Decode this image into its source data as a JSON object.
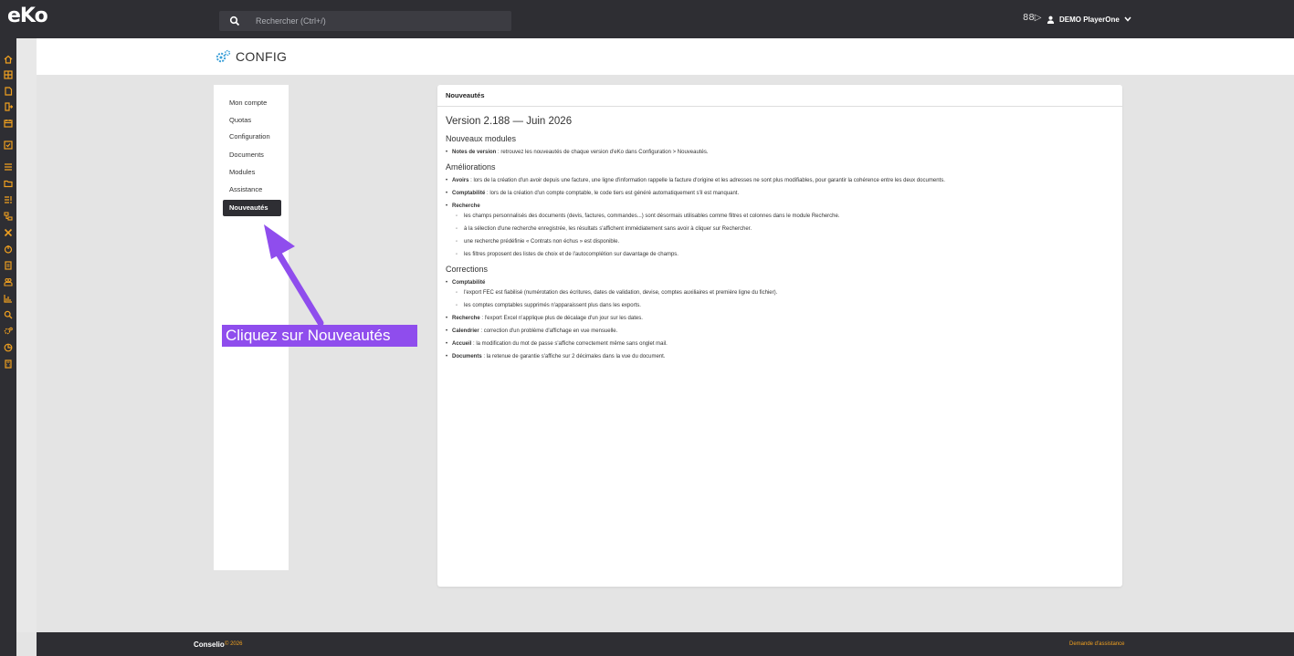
{
  "app": {
    "logo": "eKo"
  },
  "search": {
    "placeholder": "Rechercher (Ctrl+/)"
  },
  "user": {
    "name": "DEMO PlayerOne",
    "shortcut_icon": "88▷"
  },
  "page": {
    "title": "CONFIG"
  },
  "menu": {
    "items": [
      {
        "label": "Mon compte"
      },
      {
        "label": "Quotas"
      },
      {
        "label": "Configuration"
      },
      {
        "label": "Documents"
      },
      {
        "label": "Modules"
      },
      {
        "label": "Assistance"
      },
      {
        "label": "Nouveautés",
        "active": true
      }
    ]
  },
  "card": {
    "header": "Nouveautés",
    "version_title": "Version 2.188 — Juin 2026",
    "sections": {
      "new_modules": {
        "title": "Nouveaux modules",
        "items": [
          {
            "bold": "Notes de version",
            "text": " : retrouvez les nouveautés de chaque version d'eKo dans Configuration > Nouveautés."
          }
        ]
      },
      "improvements": {
        "title": "Améliorations",
        "items": [
          {
            "bold": "Avoirs",
            "text": " : lors de la création d'un avoir depuis une facture, une ligne d'information rappelle la facture d'origine et les adresses ne sont plus modifiables, pour garantir la cohérence entre les deux documents."
          },
          {
            "bold": "Comptabilité",
            "text": " : lors de la création d'un compte comptable, le code tiers est généré automatiquement s'il est manquant."
          },
          {
            "bold": "Recherche",
            "text": ""
          }
        ],
        "search_subitems": [
          "les champs personnalisés des documents (devis, factures, commandes...) sont désormais utilisables comme filtres et colonnes dans le module Recherche.",
          "à la sélection d'une recherche enregistrée, les résultats s'affichent immédiatement sans avoir à cliquer sur Rechercher.",
          "une recherche prédéfinie « Contrats non échus » est disponible.",
          "les filtres proposent des listes de choix et de l'autocomplétion sur davantage de champs."
        ]
      },
      "corrections": {
        "title": "Corrections",
        "items": [
          {
            "bold": "Comptabilité",
            "text": ""
          },
          {
            "bold": "Recherche",
            "text": " : l'export Excel n'applique plus de décalage d'un jour sur les dates."
          },
          {
            "bold": "Calendrier",
            "text": " : correction d'un problème d'affichage en vue mensuelle."
          },
          {
            "bold": "Accueil",
            "text": " : la modification du mot de passe s'affiche correctement même sans onglet mail."
          },
          {
            "bold": "Documents",
            "text": " : la retenue de garantie s'affiche sur 2 décimales dans la vue du document."
          }
        ],
        "accounting_subitems": [
          "l'export FEC est fiabilisé (numérotation des écritures, dates de validation, devise, comptes auxiliaires et première ligne du fichier).",
          "les comptes comptables supprimés n'apparaissent plus dans les exports."
        ]
      }
    }
  },
  "annotation": {
    "callout": "Cliquez sur Nouveautés"
  },
  "footer": {
    "brand": "Conselio",
    "year": "© 2026",
    "help": "Demande d'assistance"
  },
  "colors": {
    "dark": "#2e2e33",
    "accent": "#f0a020",
    "callout": "#8f4ded",
    "icon": "#f0a020",
    "config_icon": "#3a9fd8"
  }
}
